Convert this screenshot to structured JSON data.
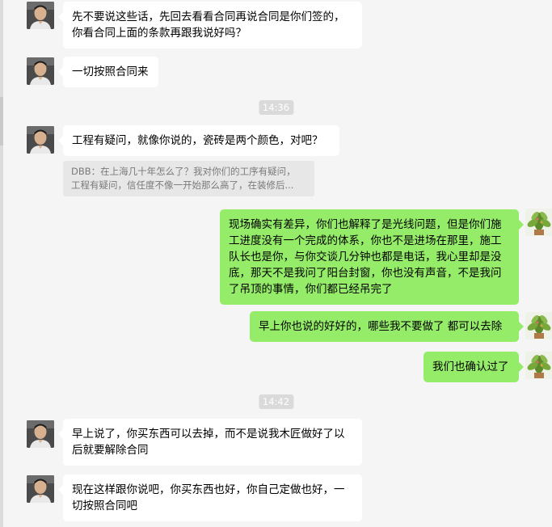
{
  "messages": [
    {
      "lines": [
        "先不要说这些话，先回去看看合同再说合同是你们签的，",
        "你看合同上面的条款再跟我说好吗？"
      ]
    },
    {
      "lines": [
        "一切按照合同来"
      ]
    },
    {
      "lines": [
        "工程有疑问，就像你说的，瓷砖是两个颜色，对吧？"
      ]
    },
    {
      "lines": [
        "现场确实有差异，你们也解释了是光线问题，但是你们施",
        "工进度没有一个完成的体系，你也不是进场在那里，施工",
        "队长也是你，与你交谈几分钟也都是电话，我心里却是没",
        "底，那天不是我问了阳台封窗，你也没有声音，不是我问",
        "了吊顶的事情，你们都已经吊完了"
      ]
    },
    {
      "lines": [
        "早上你也说的好好的，哪些我不要做了 都可以去除"
      ]
    },
    {
      "lines": [
        "我们也确认过了"
      ]
    },
    {
      "lines": [
        "早上说了，你买东西可以去掉，而不是说我木匠做好了以",
        "后就要解除合同"
      ]
    },
    {
      "lines": [
        "现在这样跟你说吧，你买东西也好，你自己定做也好，一",
        "切按照合同吧"
      ]
    }
  ],
  "quote": {
    "lines": [
      "DBB：在上海几十年怎么了？我对你们的工序有疑问，",
      "工程有疑问，信任度不像一开始那么高了，在装修后..."
    ]
  },
  "timestamps": [
    "14:36",
    "14:42"
  ],
  "colors": {
    "background": "#f5f5f5",
    "incoming_bubble": "#ffffff",
    "outgoing_bubble": "#95ec69",
    "timestamp_bg": "#dadada"
  },
  "icons": {
    "person_avatar": "avatar-person-icon",
    "plant_avatar": "avatar-plant-icon"
  }
}
